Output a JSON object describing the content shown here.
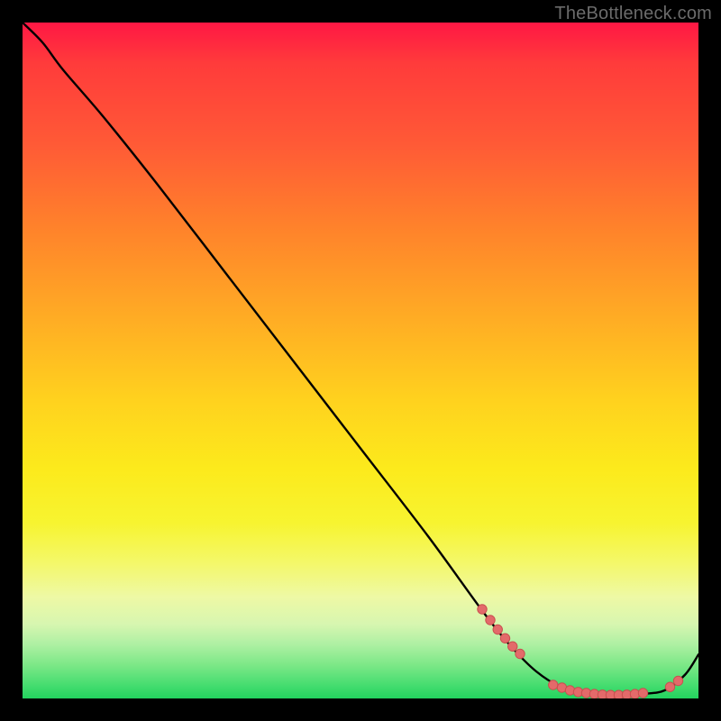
{
  "watermark": "TheBottleneck.com",
  "colors": {
    "background": "#000000",
    "gradient_top": "#ff1744",
    "gradient_mid": "#ffd21e",
    "gradient_bottom": "#23d35e",
    "curve_stroke": "#000000",
    "dot_fill": "#e36a6a",
    "dot_stroke": "#c94f4f",
    "watermark": "#6b6b6b"
  },
  "chart_data": {
    "type": "line",
    "title": "",
    "xlabel": "",
    "ylabel": "",
    "xlim": [
      0,
      100
    ],
    "ylim": [
      0,
      100
    ],
    "grid": false,
    "legend": false,
    "series": [
      {
        "name": "bottleneck-curve",
        "x": [
          0,
          3,
          6,
          12,
          20,
          30,
          40,
          50,
          60,
          68,
          72,
          76,
          80,
          83,
          86,
          89,
          92,
          95,
          98,
          100
        ],
        "y": [
          100,
          97,
          93,
          86,
          76,
          63,
          50,
          37,
          24,
          13,
          8,
          4,
          1.5,
          0.8,
          0.5,
          0.5,
          0.7,
          1.2,
          3.5,
          6.5
        ]
      }
    ],
    "markers": [
      {
        "group": "left-cluster",
        "points": [
          {
            "x": 68.0,
            "y": 13.2
          },
          {
            "x": 69.2,
            "y": 11.6
          },
          {
            "x": 70.3,
            "y": 10.2
          },
          {
            "x": 71.4,
            "y": 8.9
          },
          {
            "x": 72.5,
            "y": 7.7
          },
          {
            "x": 73.6,
            "y": 6.6
          }
        ]
      },
      {
        "group": "bottom-cluster",
        "points": [
          {
            "x": 78.5,
            "y": 2.0
          },
          {
            "x": 79.8,
            "y": 1.6
          },
          {
            "x": 81.0,
            "y": 1.2
          },
          {
            "x": 82.2,
            "y": 0.95
          },
          {
            "x": 83.4,
            "y": 0.8
          },
          {
            "x": 84.6,
            "y": 0.65
          },
          {
            "x": 85.8,
            "y": 0.55
          },
          {
            "x": 87.0,
            "y": 0.5
          },
          {
            "x": 88.2,
            "y": 0.5
          },
          {
            "x": 89.4,
            "y": 0.55
          },
          {
            "x": 90.6,
            "y": 0.65
          },
          {
            "x": 91.8,
            "y": 0.8
          }
        ]
      },
      {
        "group": "right-cluster",
        "points": [
          {
            "x": 95.8,
            "y": 1.7
          },
          {
            "x": 97.0,
            "y": 2.6
          }
        ]
      }
    ]
  }
}
